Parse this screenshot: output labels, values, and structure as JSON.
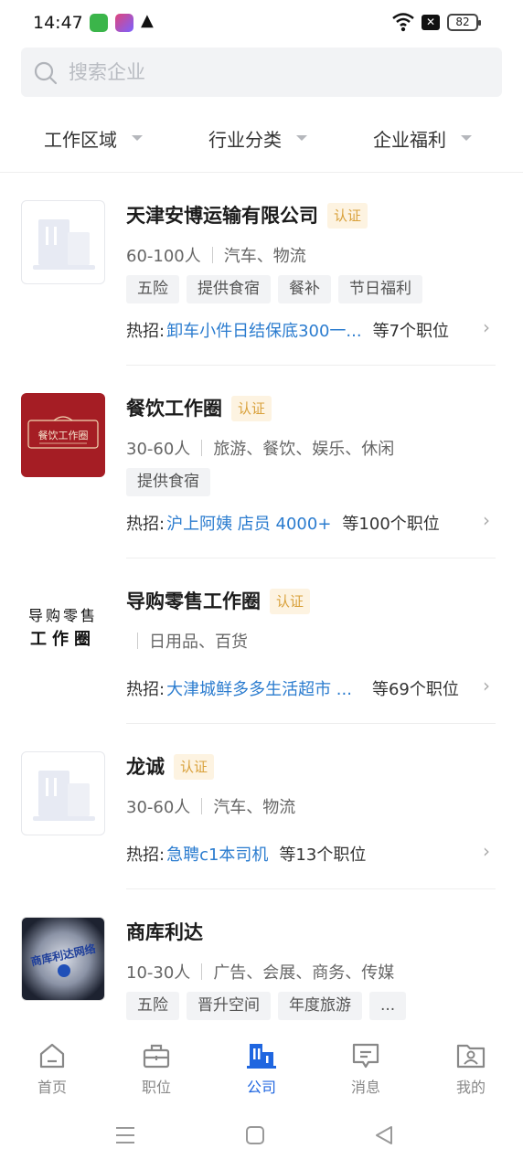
{
  "status_bar": {
    "time": "14:47",
    "battery": "82"
  },
  "search": {
    "placeholder": "搜索企业"
  },
  "filters": [
    {
      "label": "工作区域"
    },
    {
      "label": "行业分类"
    },
    {
      "label": "企业福利"
    }
  ],
  "companies": [
    {
      "name": "天津安博运输有限公司",
      "badge": "认证",
      "size": "60-100人",
      "industry": "汽车、物流",
      "tags": [
        "五险",
        "提供食宿",
        "餐补",
        "节日福利"
      ],
      "hot_label": "热招:",
      "hot_job": "卸车小件日结保底300一...",
      "job_count": "等7个职位"
    },
    {
      "name": "餐饮工作圈",
      "badge": "认证",
      "size": "30-60人",
      "industry": "旅游、餐饮、娱乐、休闲",
      "tags": [
        "提供食宿"
      ],
      "hot_label": "热招:",
      "hot_job": "沪上阿姨 店员 4000+",
      "job_count": "等100个职位",
      "logo_text": "餐饮工作圈"
    },
    {
      "name": "导购零售工作圈",
      "badge": "认证",
      "size": "",
      "industry": "日用品、百货",
      "tags": [],
      "hot_label": "热招:",
      "hot_job": "大津城鲜多多生活超市 ...",
      "job_count": "等69个职位",
      "logo_line1": "导购零售",
      "logo_line2": "工作圈"
    },
    {
      "name": "龙诚",
      "badge": "认证",
      "size": "30-60人",
      "industry": "汽车、物流",
      "tags": [],
      "hot_label": "热招:",
      "hot_job": "急聘c1本司机",
      "job_count": "等13个职位"
    },
    {
      "name": "商库利达",
      "size": "10-30人",
      "industry": "广告、会展、商务、传媒",
      "tags": [
        "五险",
        "晋升空间",
        "年度旅游",
        "..."
      ],
      "logo_text": "商库利达网络"
    }
  ],
  "tabbar": [
    {
      "label": "首页",
      "icon": "home-icon"
    },
    {
      "label": "职位",
      "icon": "briefcase-icon"
    },
    {
      "label": "公司",
      "icon": "building-icon",
      "active": true
    },
    {
      "label": "消息",
      "icon": "message-icon"
    },
    {
      "label": "我的",
      "icon": "profile-folder-icon"
    }
  ],
  "colors": {
    "accent": "#1f66e0",
    "link": "#2b7ccf",
    "badge_text": "#d9a13b",
    "badge_bg": "#fdf3e1"
  }
}
